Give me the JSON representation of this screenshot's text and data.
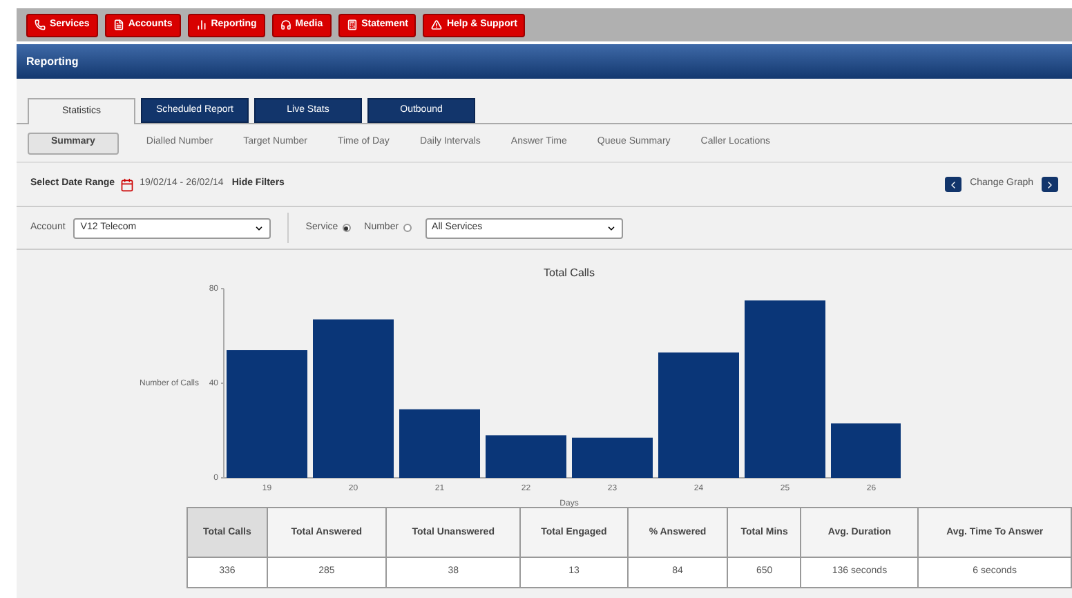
{
  "nav": [
    {
      "label": "Services"
    },
    {
      "label": "Accounts"
    },
    {
      "label": "Reporting"
    },
    {
      "label": "Media"
    },
    {
      "label": "Statement"
    },
    {
      "label": "Help & Support"
    }
  ],
  "header": {
    "title": "Reporting"
  },
  "tabs": [
    {
      "label": "Statistics",
      "selected": true
    },
    {
      "label": "Scheduled Report",
      "selected": false
    },
    {
      "label": "Live Stats",
      "selected": false
    },
    {
      "label": "Outbound",
      "selected": false
    }
  ],
  "subtabs": [
    {
      "label": "Summary",
      "selected": true
    },
    {
      "label": "Dialled Number",
      "selected": false
    },
    {
      "label": "Target Number",
      "selected": false
    },
    {
      "label": "Time of Day",
      "selected": false
    },
    {
      "label": "Daily Intervals",
      "selected": false
    },
    {
      "label": "Answer Time",
      "selected": false
    },
    {
      "label": "Queue Summary",
      "selected": false
    },
    {
      "label": "Caller Locations",
      "selected": false
    }
  ],
  "date_range": {
    "label": "Select Date Range",
    "value": "19/02/14 - 26/02/14",
    "hide_filters": "Hide Filters",
    "change_graph": "Change Graph"
  },
  "filters": {
    "account_label": "Account",
    "account": "V12 Telecom",
    "options": [
      {
        "label": "Service",
        "selected": true
      },
      {
        "label": "Number",
        "selected": false
      }
    ],
    "service": "All Services"
  },
  "chart": {
    "chart_data": {
      "type": "bar",
      "title": "Total Calls",
      "xlabel": "Days",
      "ylabel": "Number of Calls",
      "categories": [
        "19",
        "20",
        "21",
        "22",
        "23",
        "24",
        "25",
        "26"
      ],
      "series": [
        {
          "color": "#0a3678",
          "values": [
            54,
            67,
            29,
            18,
            17,
            53,
            75,
            23
          ]
        }
      ],
      "ylim": [
        0,
        80
      ],
      "yticks": [
        0,
        40,
        80
      ]
    }
  },
  "table": {
    "columns": [
      "Total Calls",
      "Total Answered",
      "Total Unanswered",
      "Total Engaged",
      "% Answered",
      "Total Mins",
      "Avg. Duration",
      "Avg. Time To Answer"
    ],
    "rows": [
      [
        "336",
        "285",
        "38",
        "13",
        "84",
        "650",
        "136 seconds",
        "6 seconds"
      ]
    ]
  }
}
